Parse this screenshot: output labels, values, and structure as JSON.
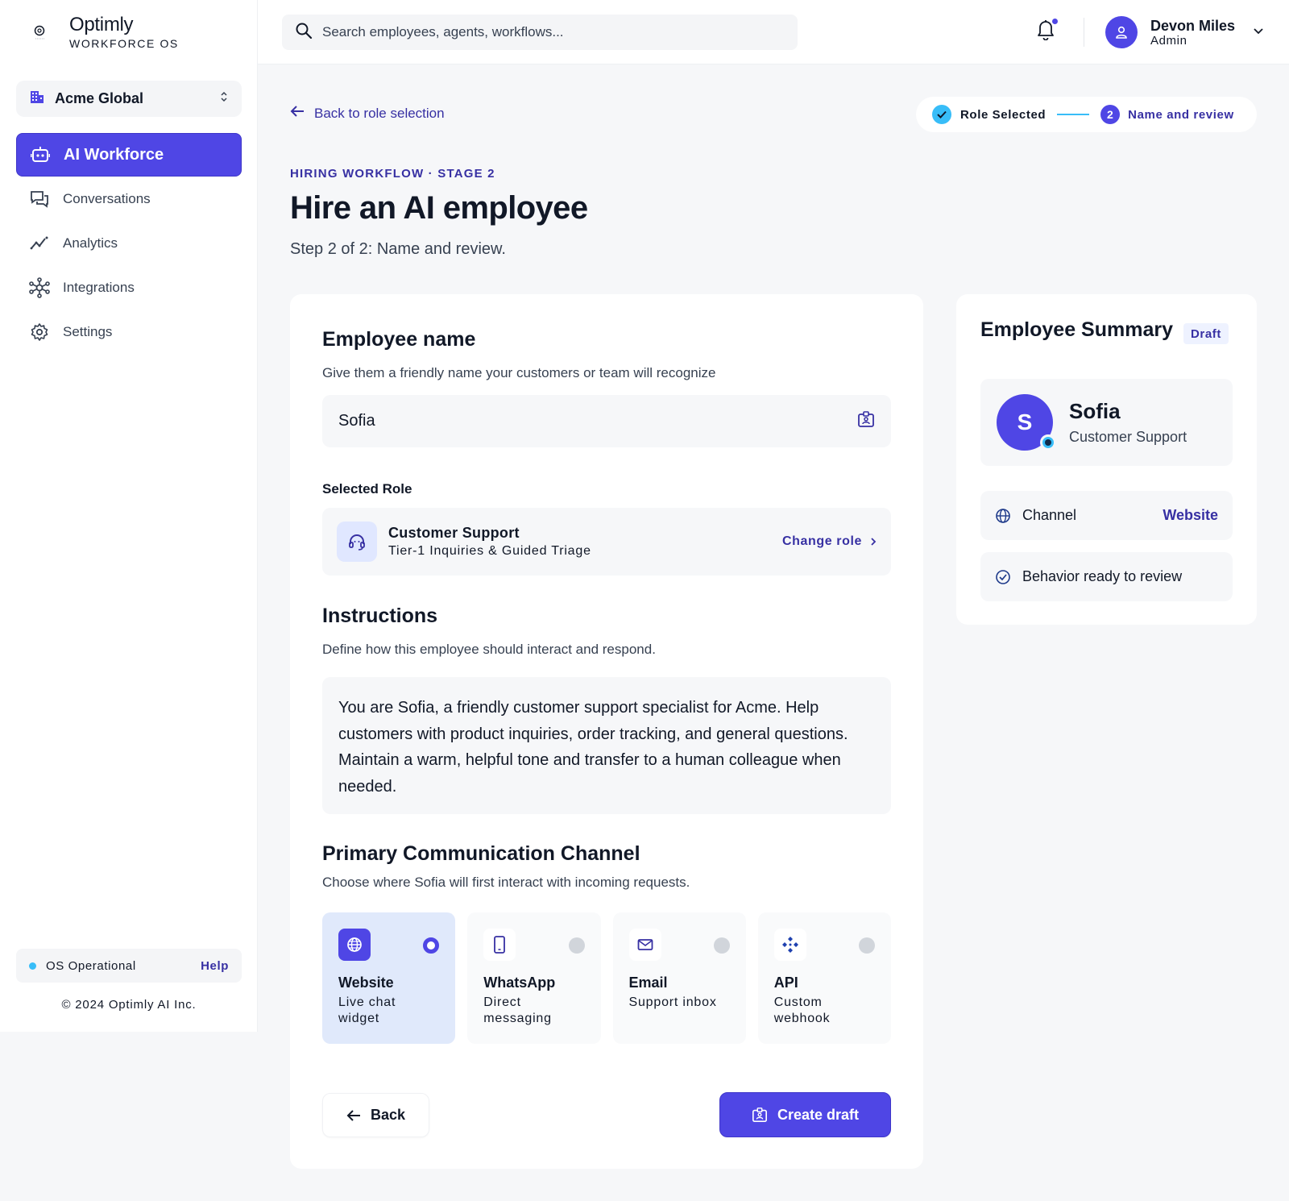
{
  "brand": {
    "name": "Optimly",
    "subtitle": "WORKFORCE OS"
  },
  "org": {
    "name": "Acme Global"
  },
  "nav": [
    {
      "label": "AI Workforce",
      "icon": "robot-icon",
      "active": true
    },
    {
      "label": "Conversations",
      "icon": "chat-icon",
      "active": false
    },
    {
      "label": "Analytics",
      "icon": "analytics-icon",
      "active": false
    },
    {
      "label": "Integrations",
      "icon": "integrations-icon",
      "active": false
    },
    {
      "label": "Settings",
      "icon": "gear-icon",
      "active": false
    }
  ],
  "status": {
    "label": "OS Operational",
    "help": "Help"
  },
  "copyright": "© 2024 Optimly AI Inc.",
  "search": {
    "placeholder": "Search employees, agents, workflows..."
  },
  "user": {
    "name": "Devon Miles",
    "role": "Admin"
  },
  "back_link": "Back to role selection",
  "stepper": {
    "step1": "Role Selected",
    "step2_number": "2",
    "step2": "Name and review"
  },
  "header": {
    "eyebrow": "HIRING WORKFLOW · STAGE 2",
    "title": "Hire an AI employee",
    "subtitle": "Step 2 of 2: Name and review."
  },
  "form": {
    "name_section": {
      "title": "Employee name",
      "description": "Give them a friendly name your customers or team will recognize",
      "value": "Sofia"
    },
    "role_section": {
      "label": "Selected Role",
      "role_name": "Customer Support",
      "role_desc": "Tier-1 Inquiries & Guided Triage",
      "change_label": "Change role"
    },
    "instructions": {
      "title": "Instructions",
      "description": "Define how this employee should interact and respond.",
      "text": "You are Sofia, a friendly customer support specialist for Acme. Help customers with product inquiries, order tracking, and general questions. Maintain a warm, helpful tone and transfer to a human colleague when needed."
    },
    "channel_section": {
      "title": "Primary Communication Channel",
      "description": "Choose where Sofia will first interact with incoming requests.",
      "options": [
        {
          "name": "Website",
          "desc": "Live chat widget",
          "icon": "globe-icon",
          "selected": true
        },
        {
          "name": "WhatsApp",
          "desc": "Direct messaging",
          "icon": "phone-icon",
          "selected": false
        },
        {
          "name": "Email",
          "desc": "Support inbox",
          "icon": "mail-icon",
          "selected": false
        },
        {
          "name": "API",
          "desc": "Custom webhook",
          "icon": "api-icon",
          "selected": false
        }
      ]
    },
    "actions": {
      "back": "Back",
      "create": "Create draft"
    }
  },
  "summary": {
    "title": "Employee Summary",
    "badge": "Draft",
    "initial": "S",
    "name": "Sofia",
    "role": "Customer Support",
    "channel_label": "Channel",
    "channel_value": "Website",
    "behavior": "Behavior ready to review"
  },
  "colors": {
    "accent": "#4f46e5",
    "accent_text": "#3730a3",
    "status": "#38bdf8"
  }
}
